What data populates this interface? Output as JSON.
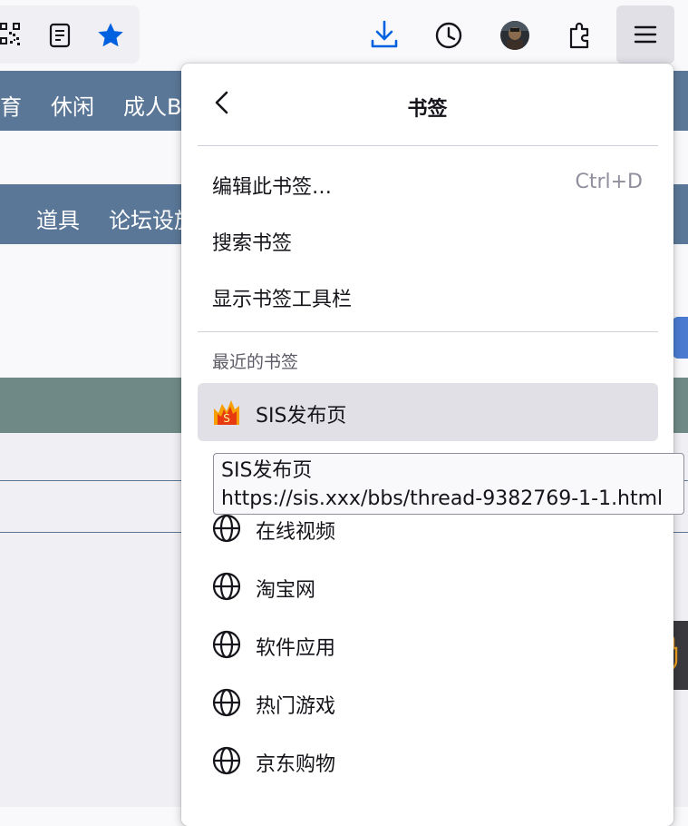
{
  "toolbar": {
    "icons": [
      "qr-code-icon",
      "reader-view-icon",
      "bookmark-star-icon",
      "downloads-icon",
      "history-icon",
      "profile-avatar",
      "extensions-icon",
      "app-menu-icon"
    ],
    "accent_color": "#0061e0"
  },
  "page": {
    "nav1_items": [
      "育",
      "休闲",
      "成人BT"
    ],
    "nav2_items": [
      "道具",
      "论坛设施"
    ]
  },
  "panel": {
    "title": "书签",
    "menu_items": [
      {
        "label": "编辑此书签…",
        "shortcut": "Ctrl+D"
      },
      {
        "label": "搜索书签"
      },
      {
        "label": "显示书签工具栏"
      }
    ],
    "recent_header": "最近的书签",
    "bookmarks": [
      {
        "label": "SIS发布页",
        "icon": "sis-favicon",
        "highlighted": true
      },
      {
        "label": "在线视频",
        "icon": "globe-icon"
      },
      {
        "label": "淘宝网",
        "icon": "globe-icon"
      },
      {
        "label": "软件应用",
        "icon": "globe-icon"
      },
      {
        "label": "热门游戏",
        "icon": "globe-icon"
      },
      {
        "label": "京东购物",
        "icon": "globe-icon"
      }
    ]
  },
  "tooltip": {
    "title": "SIS发布页",
    "url": "https://sis.xxx/bbs/thread-9382769-1-1.html"
  }
}
